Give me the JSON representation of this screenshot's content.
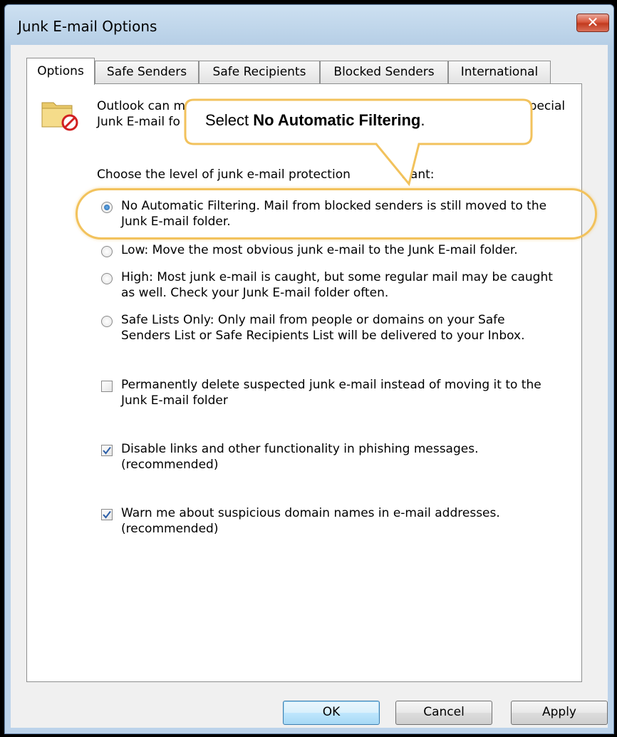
{
  "window": {
    "title": "Junk E-mail Options",
    "close_label": "✕"
  },
  "tabs": [
    {
      "label": "Options",
      "active": true
    },
    {
      "label": "Safe Senders",
      "active": false
    },
    {
      "label": "Safe Recipients",
      "active": false
    },
    {
      "label": "Blocked Senders",
      "active": false
    },
    {
      "label": "International",
      "active": false
    }
  ],
  "intro": {
    "line1_left": "Outlook can m",
    "line1_right": "a special",
    "line2_left": "Junk E-mail fo"
  },
  "level_prompt": {
    "left": "Choose the level of junk e-mail protection ",
    "right": "want:"
  },
  "options": [
    {
      "line1": "No Automatic Filtering. Mail from blocked senders is still moved to the",
      "line2": "Junk E-mail folder.",
      "selected": true
    },
    {
      "line1": "Low: Move the most obvious junk e-mail to the Junk E-mail folder.",
      "line2": "",
      "selected": false
    },
    {
      "line1": "High: Most junk e-mail is caught, but some regular mail may be caught",
      "line2": "as well. Check your Junk E-mail folder often.",
      "selected": false
    },
    {
      "line1": "Safe Lists Only: Only mail from people or domains on your Safe",
      "line2": "Senders List or Safe Recipients List will be delivered to your Inbox.",
      "selected": false
    }
  ],
  "checkboxes": [
    {
      "line1": "Permanently delete suspected junk e-mail instead of moving it to the",
      "line2": "Junk E-mail folder",
      "checked": false
    },
    {
      "line1": "Disable links and other functionality in phishing messages.",
      "line2": "(recommended)",
      "checked": true
    },
    {
      "line1": "Warn me about suspicious domain names in e-mail addresses.",
      "line2": "(recommended)",
      "checked": true
    }
  ],
  "callout": {
    "prefix": "Select ",
    "bold": "No Automatic Filtering",
    "suffix": "."
  },
  "buttons": {
    "ok": "OK",
    "cancel": "Cancel",
    "apply": "Apply"
  },
  "colors": {
    "callout_border": "#f2c25c",
    "highlight": "#f2c25c",
    "accent": "#3c7fb1"
  },
  "icons": {
    "folder": "junk-folder-icon",
    "close": "close-icon"
  }
}
